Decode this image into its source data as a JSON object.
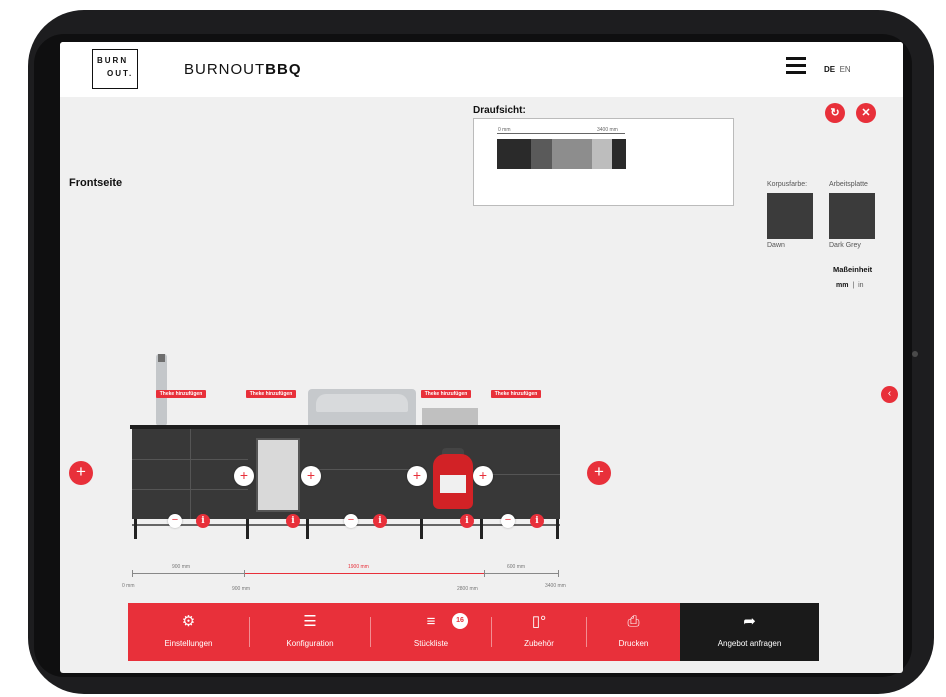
{
  "header": {
    "logo_line1": "BURN",
    "logo_line2": "OUT.",
    "brand_thin": "BURNOUT",
    "brand_bold": "BBQ",
    "lang_de": "DE",
    "lang_en": "EN"
  },
  "topview": {
    "title": "Draufsicht:",
    "dim_start": "0 mm",
    "dim_end": "3400 mm"
  },
  "front": {
    "title": "Frontseite"
  },
  "materials": {
    "body_label": "Korpusfarbe:",
    "body_value": "Dawn",
    "top_label": "Arbeitsplatte",
    "top_value": "Dark Grey"
  },
  "units": {
    "title": "Maßeinheit",
    "mm": "mm",
    "sep": "|",
    "in": "in"
  },
  "add_counter_label": "Theke hinzufügen",
  "dimensions": {
    "seg1": "900 mm",
    "seg2": "1900 mm",
    "seg3": "600 mm",
    "pos0": "0 mm",
    "pos1": "900 mm",
    "pos2": "2800 mm",
    "pos3": "3400 mm"
  },
  "toolbar": {
    "settings": "Einstellungen",
    "configuration": "Konfiguration",
    "parts_list": "Stückliste",
    "parts_count": "16",
    "accessories": "Zubehör",
    "print": "Drucken",
    "quote": "Angebot anfragen"
  },
  "icons": {
    "refresh": "refresh-icon",
    "close": "close-icon",
    "collapse": "chevron-left-icon",
    "settings": "gear-icon",
    "configuration": "sliders-icon",
    "parts_list": "list-icon",
    "accessories": "accessory-icon",
    "print": "printer-icon",
    "quote": "share-arrow-icon"
  },
  "colors": {
    "accent": "#e8303a",
    "quote_bg": "#1a1a1a",
    "swatch": "#3b3b3b"
  }
}
